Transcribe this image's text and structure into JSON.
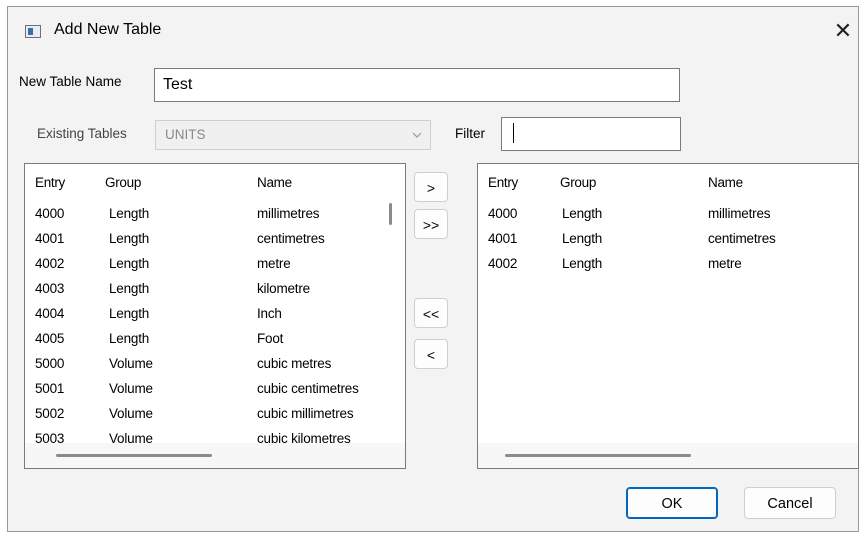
{
  "dialog": {
    "title": "Add New Table",
    "close_glyph": "✕",
    "icon": "app-window-icon"
  },
  "form": {
    "new_table_name_label": "New Table Name",
    "new_table_name_value": "Test",
    "existing_tables_label": "Existing Tables",
    "existing_tables_value": "UNITS",
    "filter_label": "Filter",
    "filter_value": ""
  },
  "left_list": {
    "columns": [
      "Entry",
      "Group",
      "Name"
    ],
    "rows": [
      {
        "entry": "4000",
        "group": "Length",
        "name": "millimetres"
      },
      {
        "entry": "4001",
        "group": "Length",
        "name": "centimetres"
      },
      {
        "entry": "4002",
        "group": "Length",
        "name": "metre"
      },
      {
        "entry": "4003",
        "group": "Length",
        "name": "kilometre"
      },
      {
        "entry": "4004",
        "group": "Length",
        "name": "Inch"
      },
      {
        "entry": "4005",
        "group": "Length",
        "name": "Foot"
      },
      {
        "entry": "5000",
        "group": "Volume",
        "name": "cubic metres"
      },
      {
        "entry": "5001",
        "group": "Volume",
        "name": "cubic centimetres"
      },
      {
        "entry": "5002",
        "group": "Volume",
        "name": "cubic millimetres"
      },
      {
        "entry": "5003",
        "group": "Volume",
        "name": "cubic kilometres"
      }
    ]
  },
  "right_list": {
    "columns": [
      "Entry",
      "Group",
      "Name"
    ],
    "rows": [
      {
        "entry": "4000",
        "group": "Length",
        "name": "millimetres"
      },
      {
        "entry": "4001",
        "group": "Length",
        "name": "centimetres"
      },
      {
        "entry": "4002",
        "group": "Length",
        "name": "metre"
      }
    ]
  },
  "transfer_buttons": {
    "add_one": ">",
    "add_all": ">>",
    "remove_all": "<<",
    "remove_one": "<"
  },
  "footer": {
    "ok_label": "OK",
    "cancel_label": "Cancel"
  },
  "colors": {
    "dialog_background": "#f3f3f3",
    "primary_border": "#0067c0"
  }
}
